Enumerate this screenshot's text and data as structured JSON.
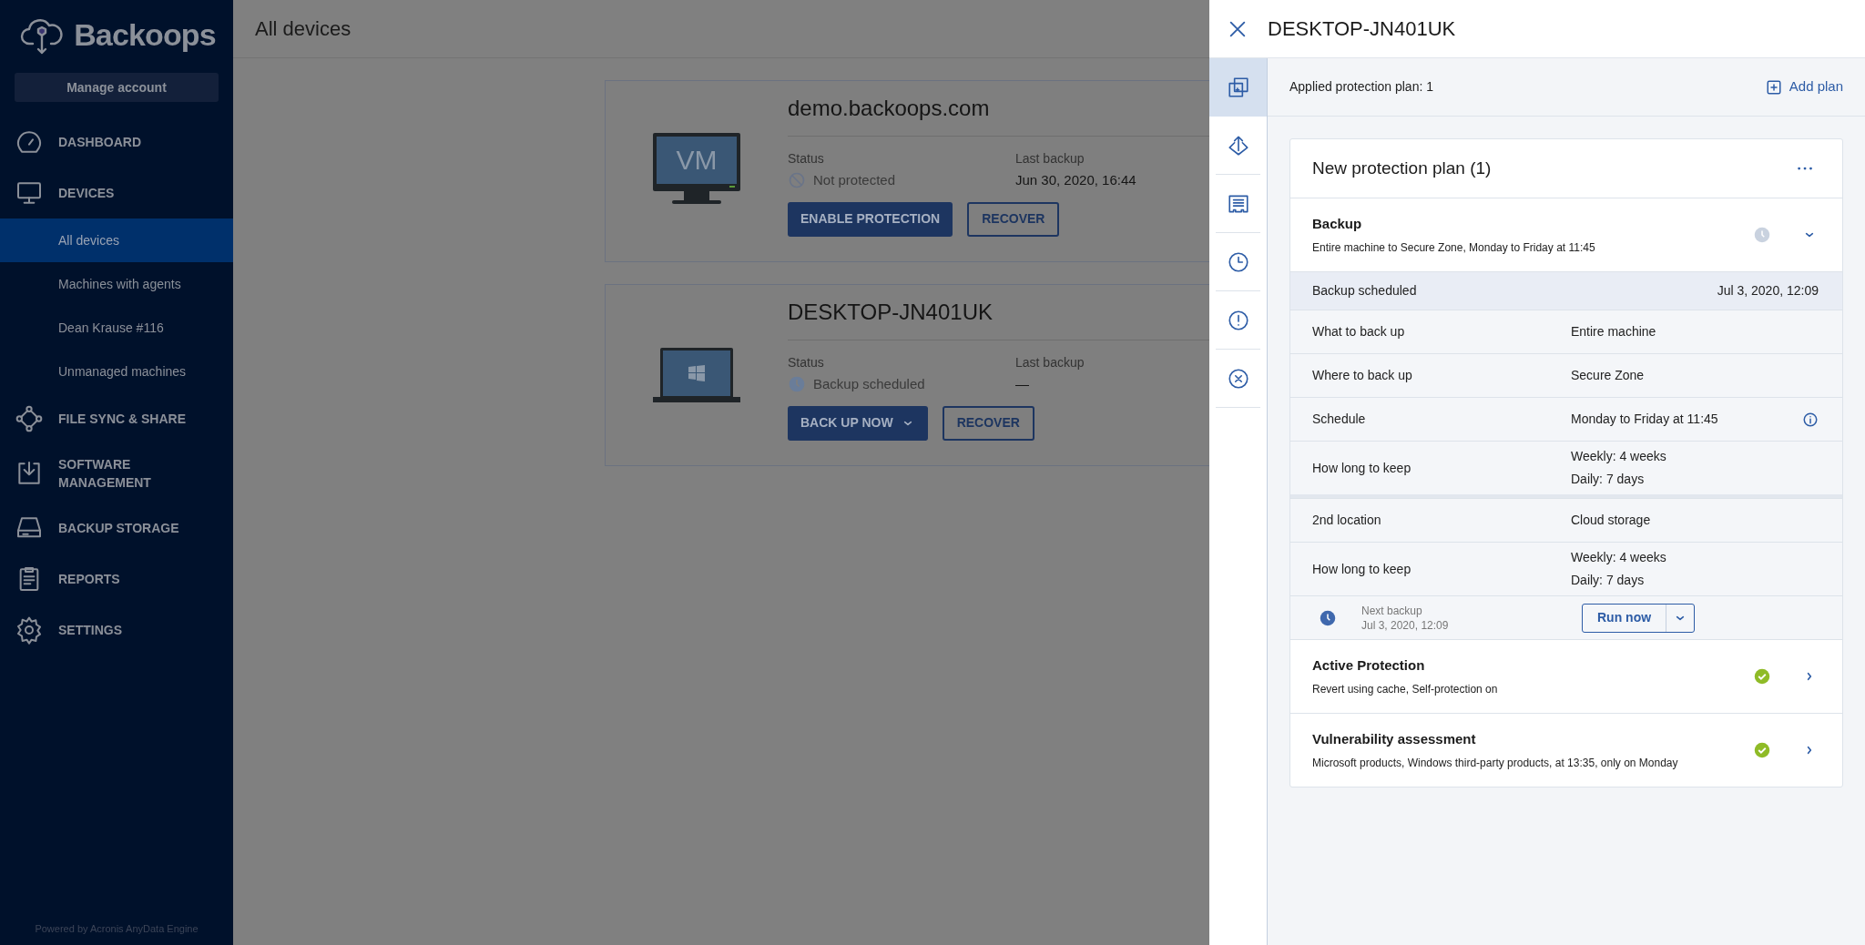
{
  "brand": {
    "name": "Backoops",
    "account_button": "Manage account",
    "footer": "Powered by Acronis AnyData Engine"
  },
  "nav": [
    {
      "kind": "section",
      "label": "DASHBOARD",
      "selected": false
    },
    {
      "kind": "section",
      "label": "DEVICES",
      "selected": false
    },
    {
      "kind": "subitem",
      "label": "All devices",
      "selected": true
    },
    {
      "kind": "subitem",
      "label": "Machines with agents",
      "selected": false
    },
    {
      "kind": "subitem",
      "label": "Dean Krause #116",
      "selected": false
    },
    {
      "kind": "subitem",
      "label": "Unmanaged machines",
      "selected": false
    },
    {
      "kind": "section",
      "label": "FILE SYNC & SHARE",
      "selected": false
    },
    {
      "kind": "section",
      "label": "SOFTWARE MANAGEMENT",
      "selected": false
    },
    {
      "kind": "section",
      "label": "BACKUP STORAGE",
      "selected": false
    },
    {
      "kind": "section",
      "label": "REPORTS",
      "selected": false
    },
    {
      "kind": "section",
      "label": "SETTINGS",
      "selected": false
    }
  ],
  "page_title": "All devices",
  "devices": [
    {
      "kind": "vm",
      "screen_text": "VM",
      "name": "demo.backoops.com",
      "status_label": "Status",
      "status": {
        "kind": "not_protected",
        "text": "Not protected"
      },
      "last_backup_label": "Last backup",
      "last_backup": "Jun 30, 2020, 16:44",
      "buttons": [
        {
          "label": "ENABLE PROTECTION",
          "kind": "primary",
          "dropdown": false
        },
        {
          "label": "RECOVER",
          "kind": "outline",
          "dropdown": false
        }
      ]
    },
    {
      "kind": "laptop",
      "name": "DESKTOP-JN401UK",
      "status_label": "Status",
      "status": {
        "kind": "scheduled",
        "text": "Backup scheduled"
      },
      "last_backup_label": "Last backup",
      "last_backup": "—",
      "buttons": [
        {
          "label": "BACK UP NOW",
          "kind": "primary",
          "dropdown": true
        },
        {
          "label": "RECOVER",
          "kind": "outline",
          "dropdown": false
        }
      ]
    }
  ],
  "panel": {
    "title": "DESKTOP-JN401UK",
    "rail": [
      {
        "selected": true
      },
      {
        "selected": false
      },
      {
        "selected": false
      },
      {
        "selected": false
      },
      {
        "selected": false
      },
      {
        "selected": false
      }
    ],
    "applied_text": "Applied protection plan: 1",
    "add_plan": "Add plan",
    "plan": {
      "title": "New protection plan (1)",
      "sections": [
        {
          "kind": "scheduled",
          "title": "Backup",
          "subtitle": "Entire machine to Secure Zone, Monday to Friday at 11:45",
          "expanded": true,
          "status_row": {
            "label": "Backup scheduled",
            "value": "Jul 3, 2020, 12:09"
          },
          "groups": [
            [
              {
                "label": "What to back up",
                "values": [
                  "Entire machine"
                ],
                "info": false
              },
              {
                "label": "Where to back up",
                "values": [
                  "Secure Zone"
                ],
                "info": false
              },
              {
                "label": "Schedule",
                "values": [
                  "Monday to Friday at 11:45"
                ],
                "info": true
              },
              {
                "label": "How long to keep",
                "values": [
                  "Weekly: 4 weeks",
                  "Daily: 7 days"
                ],
                "info": false
              }
            ],
            [
              {
                "label": "2nd location",
                "values": [
                  "Cloud storage"
                ],
                "info": false
              },
              {
                "label": "How long to keep",
                "values": [
                  "Weekly: 4 weeks",
                  "Daily: 7 days"
                ],
                "info": false
              }
            ]
          ],
          "next": {
            "label": "Next backup",
            "date": "Jul 3, 2020, 12:09",
            "button": "Run now"
          }
        },
        {
          "kind": "ok",
          "title": "Active Protection",
          "subtitle": "Revert using cache, Self-protection on",
          "expanded": false
        },
        {
          "kind": "ok",
          "title": "Vulnerability assessment",
          "subtitle": "Microsoft products, Windows third-party products, at 13:35, only on Monday",
          "expanded": false
        }
      ]
    }
  }
}
